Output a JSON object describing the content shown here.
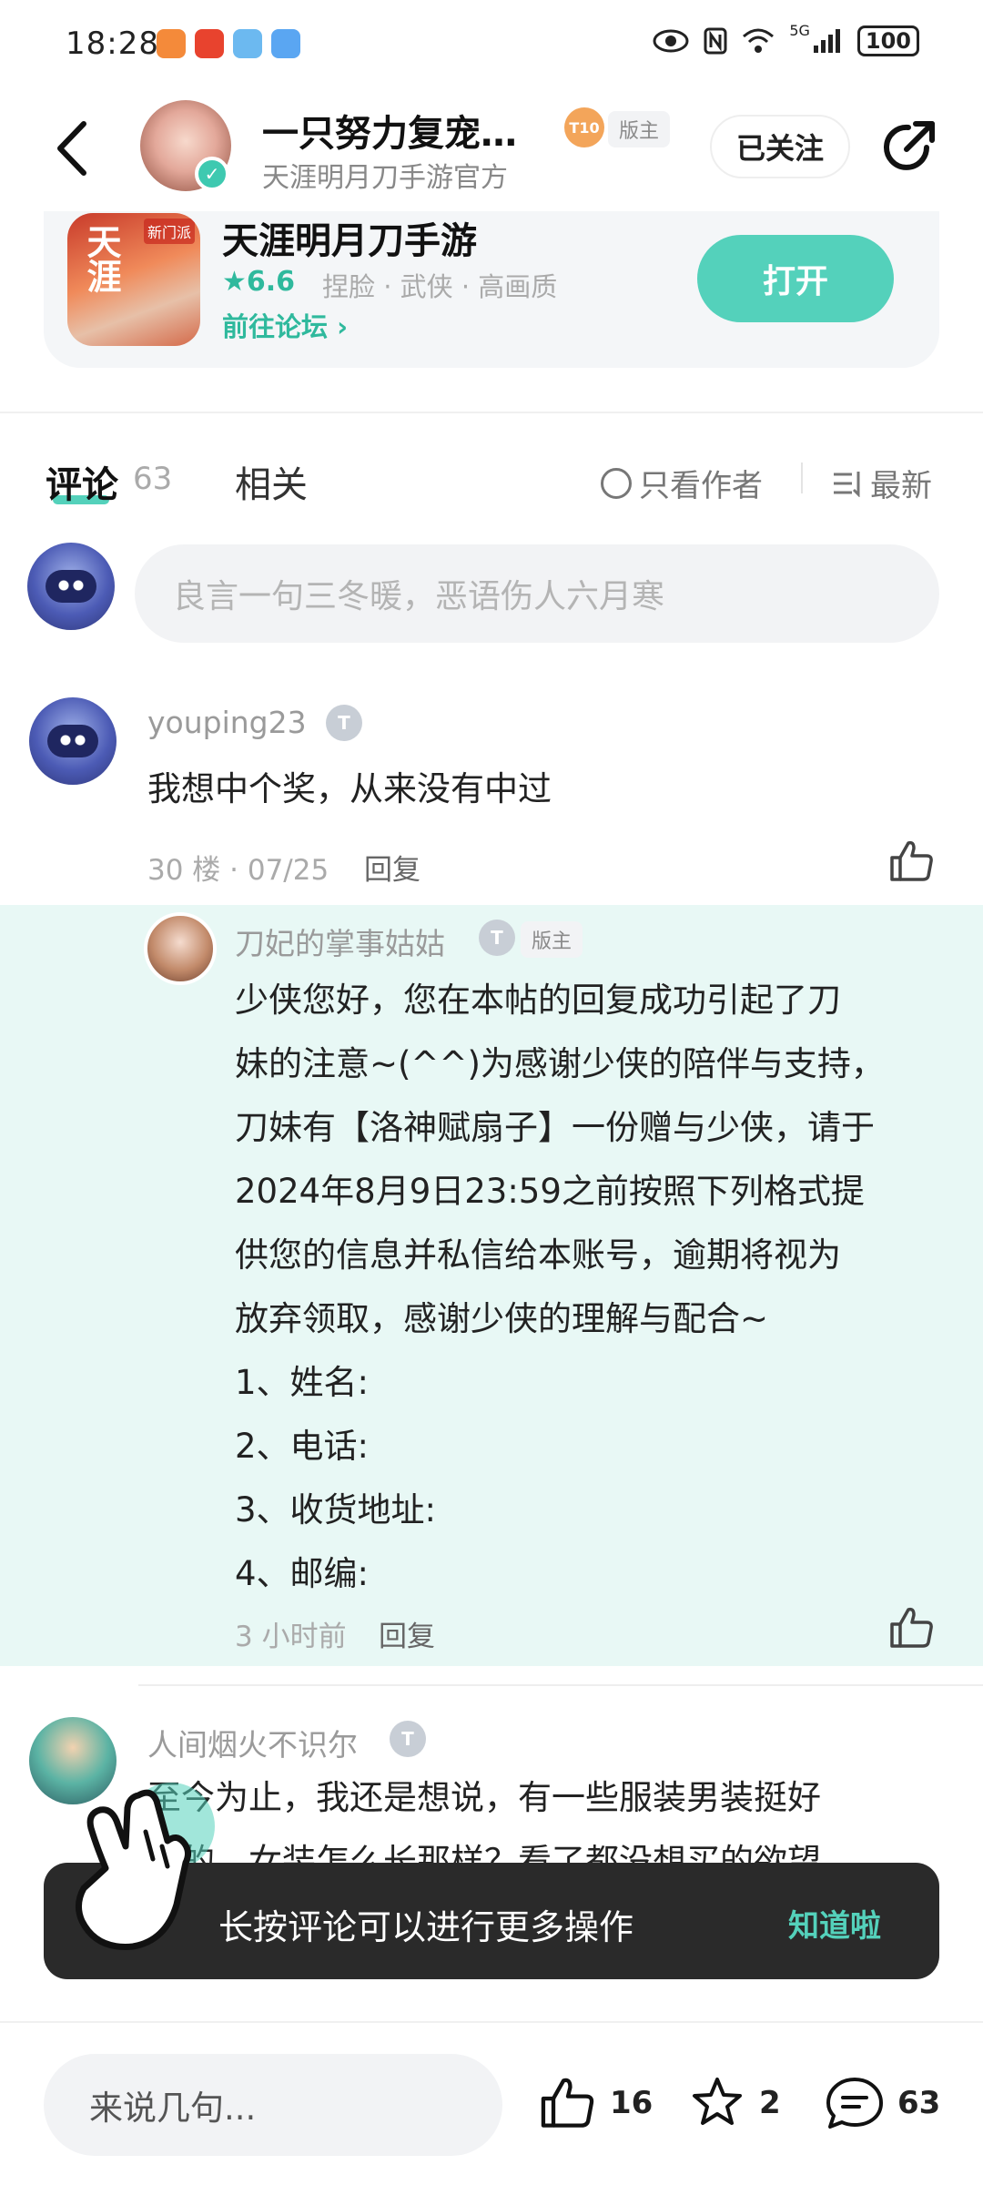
{
  "status_bar": {
    "time": "18:28",
    "network": "5G",
    "battery": "100",
    "icons": [
      "eye-icon",
      "nfc-icon",
      "wifi-icon",
      "signal-icon"
    ]
  },
  "header": {
    "title": "一只努力复宠…",
    "subtitle": "天涯明月刀手游官方",
    "level": "T10",
    "mod_tag": "版主",
    "follow_label": "已关注"
  },
  "game_card": {
    "name": "天涯明月刀手游",
    "rating": "★6.6",
    "tags": "捏脸 · 武侠 · 高画质",
    "forum_link": "前往论坛 ›",
    "open_label": "打开",
    "icon_text": "天涯",
    "icon_badge": "新门派"
  },
  "tabs": {
    "comments_label": "评论",
    "comments_count": "63",
    "related_label": "相关",
    "author_only_label": "只看作者",
    "sort_label": "最新"
  },
  "comment_input": {
    "placeholder": "良言一句三冬暖，恶语伤人六月寒"
  },
  "comments": [
    {
      "user": "youping23",
      "level": "T",
      "text": "我想中个奖，从来没有中过",
      "meta": "30 楼 · 07/25",
      "reply_label": "回复"
    },
    {
      "user": "人间烟火不识尔",
      "level": "T",
      "text_line1": "至今为止，我还是想说，有一些服装男装挺好",
      "text_line2": "看的，女装怎么长那样？看了都没想买的欲望"
    }
  ],
  "reply": {
    "user": "刀妃的掌事姑姑",
    "level": "T",
    "mod_tag": "版主",
    "lines": [
      "少侠您好，您在本帖的回复成功引起了刀",
      "妹的注意~(^^)为感谢少侠的陪伴与支持，",
      "刀妹有【洛神赋扇子】一份赠与少侠，请于",
      "2024年8月9日23:59之前按照下列格式提",
      "供您的信息并私信给本账号，逾期将视为",
      "放弃领取，感谢少侠的理解与配合~",
      "1、姓名:",
      "2、电话:",
      "3、收货地址:",
      "4、邮编:"
    ],
    "time": "3 小时前",
    "reply_label": "回复"
  },
  "toast": {
    "text": "长按评论可以进行更多操作",
    "ok_label": "知道啦"
  },
  "bottom_bar": {
    "input_placeholder": "来说几句...",
    "likes": "16",
    "stars": "2",
    "comments": "63"
  },
  "colors": {
    "accent": "#54d1bb",
    "accent_text": "#2fb99d",
    "reply_bg": "#e8f8f5",
    "toast_bg": "#2a2a2a"
  }
}
